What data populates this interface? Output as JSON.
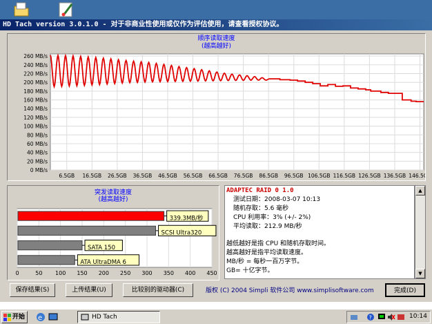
{
  "window": {
    "title": "HD Tach version 3.0.1.0  - 对于非商业性使用或仅作为评估使用，请查看授权协议。"
  },
  "colors": {
    "titlebar": "#0a246a",
    "curve": "#e00000",
    "bar_primary": "#ff0000",
    "bar_secondary": "#808080",
    "label_bg": "#ffffc0",
    "accent_text": "#cc0000"
  },
  "desktop": {
    "icons": [
      "folder-icon",
      "paint-icon"
    ]
  },
  "read_chart": {
    "title_line1": "顺序读取速度",
    "title_line2": "(越高越好)"
  },
  "burst_chart": {
    "title_line1": "突发读取速度",
    "title_line2": "(越高越好)"
  },
  "chart_data": [
    {
      "type": "line",
      "title": "顺序读取速度 (越高越好)",
      "y_tick_labels": [
        "0 MB/s",
        "20 MB/s",
        "40 MB/s",
        "60 MB/s",
        "80 MB/s",
        "100 MB/s",
        "120 MB/s",
        "140 MB/s",
        "160 MB/s",
        "180 MB/s",
        "200 MB/s",
        "220 MB/s",
        "240 MB/s",
        "260 MB/s"
      ],
      "x_tick_labels": [
        "6.5GB",
        "16.5GB",
        "26.5GB",
        "36.5GB",
        "46.5GB",
        "56.5GB",
        "66.5GB",
        "76.5GB",
        "86.5GB",
        "96.5GB",
        "106.5GB",
        "116.5GB",
        "126.5GB",
        "136.5GB",
        "146.5GB"
      ],
      "ylim": [
        0,
        265
      ],
      "xlim": [
        0,
        148
      ],
      "grid": true,
      "series": [
        {
          "osc_x": [
            0,
            10,
            20,
            30,
            40,
            50,
            60,
            70,
            80,
            87
          ],
          "osc_max": [
            262,
            260,
            256,
            250,
            245,
            237,
            229,
            220,
            214,
            208
          ],
          "osc_min": [
            190,
            192,
            195,
            199,
            201,
            202,
            203,
            204,
            205,
            205
          ],
          "osc_period_gb": 3.0,
          "step_x": [
            87,
            91,
            95,
            98,
            101,
            104,
            107,
            110,
            113,
            116,
            119,
            122,
            125,
            127,
            131,
            134,
            136,
            139.5,
            143,
            145,
            148
          ],
          "step_values": [
            208,
            206,
            205,
            203,
            200,
            197,
            192,
            195,
            191,
            192,
            187,
            185,
            183,
            180,
            177,
            175,
            175,
            160,
            157,
            156,
            155
          ]
        }
      ]
    },
    {
      "type": "bar",
      "title": "突发读取速度 (越高越好)",
      "categories": [
        "339.3MB/秒",
        "SCSI Ultra320",
        "SATA 150",
        "ATA UltraDMA 6"
      ],
      "values": [
        339.3,
        320,
        150,
        133
      ],
      "xlim": [
        0,
        450
      ],
      "x_tick_labels": [
        "0",
        "50",
        "100",
        "150",
        "200",
        "250",
        "300",
        "350",
        "400",
        "450"
      ]
    }
  ],
  "info": {
    "heading": "ADAPTEC RAID 0 1.0",
    "lines": [
      "测试日期：2008-03-07     10:13",
      "随机存取：5.6 毫秒",
      "CPU 利用率：3% (+/- 2%)",
      "平均读取：212.9 MB/秒"
    ],
    "notes": [
      "越低越好是指 CPU 和随机存取时间。",
      "越高越好是指平均读取速度。",
      "MB/秒 = 每秒一百万字节。",
      "GB= 十亿字节。"
    ]
  },
  "buttons": {
    "save": "保存结果(S)",
    "upload": "上传结果(U)",
    "compare": "比较别的驱动器(C)",
    "done": "完成(D)"
  },
  "copyright": "版权 (C) 2004 Simpli 软件公司 www.simplisoftware.com",
  "taskbar": {
    "start": "开始",
    "task": "HD Tach",
    "clock": "10:14",
    "quicklaunch": [
      "ie-icon",
      "desktop-icon"
    ],
    "tray_icons": [
      "network-icon",
      "help-icon",
      "monitor-icon",
      "volume-muted-icon",
      "input-icon"
    ]
  }
}
